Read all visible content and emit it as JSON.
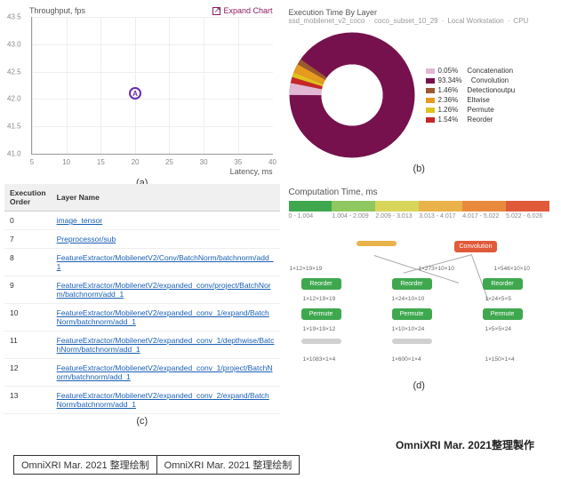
{
  "scatter": {
    "ylabel": "Throughput, fps",
    "xlabel": "Latency, ms",
    "expand": "Expand Chart",
    "point_label": "A"
  },
  "donut": {
    "title": "Execution Time By Layer",
    "crumbs": [
      "ssd_mobilenet_v2_coco",
      "coco_subset_10_29",
      "Local Workstation",
      "CPU"
    ]
  },
  "legend": {
    "i0": {
      "pct": "0.05%",
      "name": "Concatenation"
    },
    "i1": {
      "pct": "93.34%",
      "name": "Convolution"
    },
    "i2": {
      "pct": "1.46%",
      "name": "Detectionoutpu"
    },
    "i3": {
      "pct": "2.36%",
      "name": "Eltwise"
    },
    "i4": {
      "pct": "1.26%",
      "name": "Permute"
    },
    "i5": {
      "pct": "1.54%",
      "name": "Reorder"
    }
  },
  "table": {
    "h0": "Execution Order",
    "h1": "Layer Name",
    "r0": {
      "o": "0",
      "n": "image_tensor"
    },
    "r1": {
      "o": "7",
      "n": "Preprocessor/sub"
    },
    "r2": {
      "o": "8",
      "n": "FeatureExtractor/MobilenetV2/Conv/BatchNorm/batchnorm/add_1"
    },
    "r3": {
      "o": "9",
      "n": "FeatureExtractor/MobilenetV2/expanded_conv/project/BatchNorm/batchnorm/add_1"
    },
    "r4": {
      "o": "10",
      "n": "FeatureExtractor/MobilenetV2/expanded_conv_1/expand/BatchNorm/batchnorm/add_1"
    },
    "r5": {
      "o": "11",
      "n": "FeatureExtractor/MobilenetV2/expanded_conv_1/depthwise/BatchNorm/batchnorm/add_1"
    },
    "r6": {
      "o": "12",
      "n": "FeatureExtractor/MobilenetV2/expanded_conv_1/project/BatchNorm/batchnorm/add_1"
    },
    "r7": {
      "o": "13",
      "n": "FeatureExtractor/MobilenetV2/expanded_conv_2/expand/BatchNorm/batchnorm/add_1"
    }
  },
  "comp": {
    "title": "Computation Time, ms",
    "b0": "0 - 1.004",
    "b1": "1.004 - 2.009",
    "b2": "2.009 - 3.013",
    "b3": "3.013 - 4.017",
    "b4": "4.017 - 5.022",
    "b5": "5.022 - 6.026"
  },
  "nodes": {
    "n0": "",
    "n1": "Convolution",
    "n2": "Reorder",
    "n3": "Reorder",
    "n4": "Reorder",
    "n5": "Permute",
    "n6": "Permute",
    "n7": "Permute",
    "n8": "",
    "n9": "",
    "d0": "1×12×19×19",
    "d1": "1×273×10×10",
    "d2": "1×546×10×10",
    "d3": "1×12×19×19",
    "d4": "1×24×10×10",
    "d5": "1×24×5×5",
    "d6": "1×19×19×12",
    "d7": "1×10×10×24",
    "d8": "1×5×5×24",
    "d9": "1×1083×1×4",
    "d10": "1×600×1×4",
    "d11": "1×150×1×4"
  },
  "labels": {
    "a": "(a)",
    "b": "(b)",
    "c": "(c)",
    "d": "(d)"
  },
  "watermark": "OmniXRI Mar. 2021整理製作",
  "foot": {
    "l": "OmniXRI Mar. 2021 整理绘制",
    "r": "OmniXRI Mar. 2021 整理绘制"
  },
  "chart_data": [
    {
      "type": "scatter",
      "title": "Throughput, fps",
      "xlabel": "Latency, ms",
      "ylabel": "Throughput, fps",
      "xlim": [
        5,
        40
      ],
      "ylim": [
        41.0,
        43.5
      ],
      "xticks": [
        5,
        10,
        15,
        20,
        25,
        30,
        35,
        40
      ],
      "yticks": [
        41.0,
        41.5,
        42.0,
        42.5,
        43.0,
        43.5
      ],
      "series": [
        {
          "name": "A",
          "x": [
            20
          ],
          "y": [
            42.1
          ]
        }
      ]
    },
    {
      "type": "pie",
      "title": "Execution Time By Layer",
      "categories": [
        "Concatenation",
        "Convolution",
        "Detectionoutpu",
        "Eltwise",
        "Permute",
        "Reorder"
      ],
      "values": [
        0.05,
        93.34,
        1.46,
        2.36,
        1.26,
        1.54
      ],
      "colors": [
        "#e1b7d3",
        "#76114d",
        "#9a5a2e",
        "#e69a1f",
        "#e0c21c",
        "#c62828"
      ]
    },
    {
      "type": "table",
      "title": "Execution Order / Layer Name",
      "columns": [
        "Execution Order",
        "Layer Name"
      ],
      "rows": [
        [
          0,
          "image_tensor"
        ],
        [
          7,
          "Preprocessor/sub"
        ],
        [
          8,
          "FeatureExtractor/MobilenetV2/Conv/BatchNorm/batchnorm/add_1"
        ],
        [
          9,
          "FeatureExtractor/MobilenetV2/expanded_conv/project/BatchNorm/batchnorm/add_1"
        ],
        [
          10,
          "FeatureExtractor/MobilenetV2/expanded_conv_1/expand/BatchNorm/batchnorm/add_1"
        ],
        [
          11,
          "FeatureExtractor/MobilenetV2/expanded_conv_1/depthwise/BatchNorm/batchnorm/add_1"
        ],
        [
          12,
          "FeatureExtractor/MobilenetV2/expanded_conv_1/project/BatchNorm/batchnorm/add_1"
        ],
        [
          13,
          "FeatureExtractor/MobilenetV2/expanded_conv_2/expand/BatchNorm/batchnorm/add_1"
        ]
      ]
    },
    {
      "type": "heatmap",
      "title": "Computation Time, ms",
      "bins": [
        "0 - 1.004",
        "1.004 - 2.009",
        "2.009 - 3.013",
        "3.013 - 4.017",
        "4.017 - 5.022",
        "5.022 - 6.026"
      ],
      "colors": [
        "#3fa84f",
        "#8fc760",
        "#d8d65a",
        "#e9b24a",
        "#e88a3d",
        "#e05a3a"
      ]
    }
  ]
}
